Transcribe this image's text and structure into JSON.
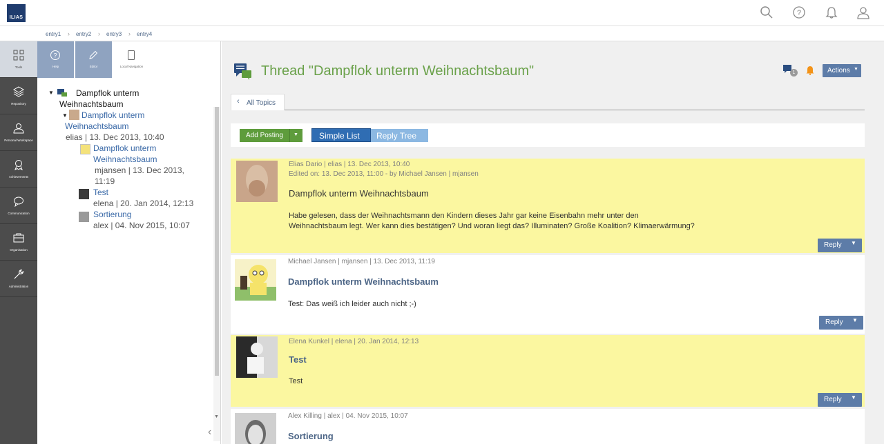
{
  "header": {
    "logo_text": "ILIAS"
  },
  "breadcrumbs": [
    "entry1",
    "entry2",
    "entry3",
    "entry4"
  ],
  "mainbar": [
    {
      "label": "Tools",
      "icon": "grid-icon"
    },
    {
      "label": "Repository",
      "icon": "layers-icon"
    },
    {
      "label": "Personal Workspace",
      "icon": "user-icon"
    },
    {
      "label": "Achievements",
      "icon": "award-icon"
    },
    {
      "label": "Communication",
      "icon": "speech-bubble-icon"
    },
    {
      "label": "Organisation",
      "icon": "briefcase-icon"
    },
    {
      "label": "Administration",
      "icon": "wrench-icon"
    }
  ],
  "slate_tabs": [
    {
      "label": "Help",
      "icon": "help-icon"
    },
    {
      "label": "Editor",
      "icon": "pencil-icon"
    },
    {
      "label": "Local Navigation",
      "icon": "document-icon"
    }
  ],
  "tree": {
    "root": "Dampflok unterm Weihnachtsbaum",
    "node1_title": "Dampflok unterm Weihnachtsbaum",
    "node1_meta": "elias | 13. Dec 2013, 10:40",
    "node2_title": "Dampflok unterm Weihnachtsbaum",
    "node2_meta": "mjansen | 13. Dec 2013, 11:19",
    "node3_title": "Test",
    "node3_meta": "elena | 20. Jan 2014, 12:13",
    "node4_title": "Sortierung",
    "node4_meta": "alex | 04. Nov 2015, 10:07"
  },
  "content": {
    "thread_title": "Thread \"Dampflok unterm Weihnachtsbaum\"",
    "actions_label": "Actions",
    "notifications_badge": "1",
    "all_topics": "All Topics",
    "add_posting": "Add Posting",
    "view_simple": "Simple List",
    "view_tree": "Reply Tree"
  },
  "postings": [
    {
      "author": "Elias Dario",
      "login": "elias",
      "date": "13. Dec 2013, 10:40",
      "edited": "Edited on: 13. Dec 2013, 11:00 - by Michael Jansen | mjansen",
      "title": "Dampflok unterm Weihnachtsbaum",
      "text_line1": "Habe gelesen, dass der Weihnachtsmann den Kindern dieses Jahr gar keine Eisenbahn mehr unter den",
      "text_line2": "Weihnachtsbaum legt. Wer kann dies bestätigen? Und woran liegt das? Illuminaten? Große Koalition? Klimaerwärmung?",
      "reply": "Reply"
    },
    {
      "author": "Michael Jansen",
      "login": "mjansen",
      "date": "13. Dec 2013, 11:19",
      "title": "Dampflok unterm Weihnachtsbaum",
      "text": "Test: Das weiß ich leider auch nicht ;-)",
      "reply": "Reply"
    },
    {
      "author": "Elena Kunkel",
      "login": "elena",
      "date": "20. Jan 2014, 12:13",
      "title": "Test",
      "text": "Test",
      "reply": "Reply"
    },
    {
      "author": "Alex Killing",
      "login": "alex",
      "date": "04. Nov 2015, 10:07",
      "title": "Sortierung"
    }
  ],
  "colors": {
    "highlight": "#fbf7a0",
    "title_green": "#6aa14a",
    "button_blue": "#5d7ca8",
    "add_green": "#5e9c3c",
    "mainbar": "#4c4c4c"
  }
}
